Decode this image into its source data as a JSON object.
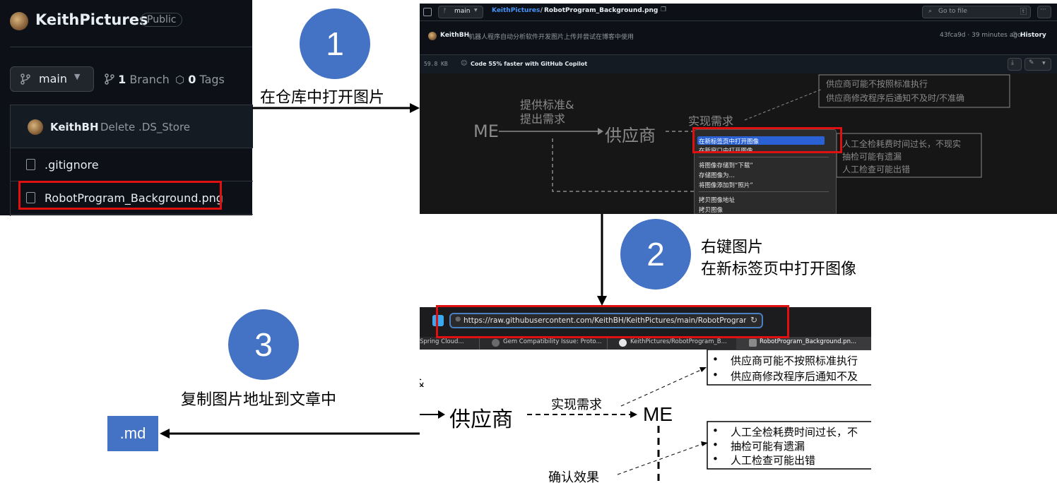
{
  "repo_panel": {
    "repo_name": "KeithPictures",
    "visibility": "Public",
    "branch": "main",
    "branch_count": "1",
    "branch_label": "Branch",
    "tag_count": "0",
    "tag_label": "Tags",
    "commit_author": "KeithBH",
    "commit_message": "Delete .DS_Store",
    "files": [
      ".gitignore",
      "RobotProgram_Background.png"
    ]
  },
  "file_panel": {
    "branch": "main",
    "repo": "KeithPictures",
    "path_sep": " / ",
    "file": "RobotProgram_Background.png",
    "search_placeholder": "Go to file",
    "search_key": "t",
    "commit_author": "KeithBH",
    "commit_message": "机器人程序自动分析软件开发图片上传并尝试在博客中使用",
    "commit_meta": "43fca9d · 39 minutes ago",
    "history": "History",
    "size": "59.8 KB",
    "copilot": "Code 55% faster with GitHub Copilot",
    "context_menu": [
      "在新标签页中打开图像",
      "在新窗口中打开图像",
      "将图像存储到“下载”",
      "存储图像为…",
      "将图像添加到“照片”",
      "拷贝图像地址",
      "拷贝图像"
    ]
  },
  "browser_panel": {
    "url": "https://raw.githubusercontent.com/KeithBH/KeithPictures/main/RobotProgram_Backgrou",
    "tabs": [
      "Spring Cloud...",
      "Gem Compatibility Issue: Proto...",
      "KeithPictures/RobotProgram_B...",
      "RobotProgram_Background.pn..."
    ]
  },
  "diagram_image": {
    "me": "ME",
    "supplier": "供应商",
    "provide_label_1": "提供标准&",
    "provide_label_2": "提出需求",
    "implement": "实现需求",
    "confirm": "确认效果",
    "issues_1": [
      "供应商可能不按照标准执行",
      "供应商修改程序后通知不及时/不准确"
    ],
    "issues_2": [
      "人工全检耗费时间过长，不现实",
      "抽检可能有遗漏",
      "人工检查可能出错"
    ],
    "bullet": "•",
    "frag": "&",
    "b_issue1": [
      "供应商可能不按照标准执行",
      "供应商修改程序后通知不及"
    ],
    "b_issue2": [
      "人工全检耗费时间过长，不",
      "抽检可能有遗漏",
      "人工检查可能出错"
    ]
  },
  "steps": [
    {
      "number": "1",
      "lines": [
        "在仓库中打开图片"
      ]
    },
    {
      "number": "2",
      "lines": [
        "右键图片",
        "在新标签页中打开图像"
      ]
    },
    {
      "number": "3",
      "lines": [
        "复制图片地址到文章中"
      ]
    }
  ],
  "target": ".md",
  "colors": {
    "step_blue": "#4472c4",
    "highlight_red": "#e01010",
    "github_bg": "#0d1117"
  }
}
